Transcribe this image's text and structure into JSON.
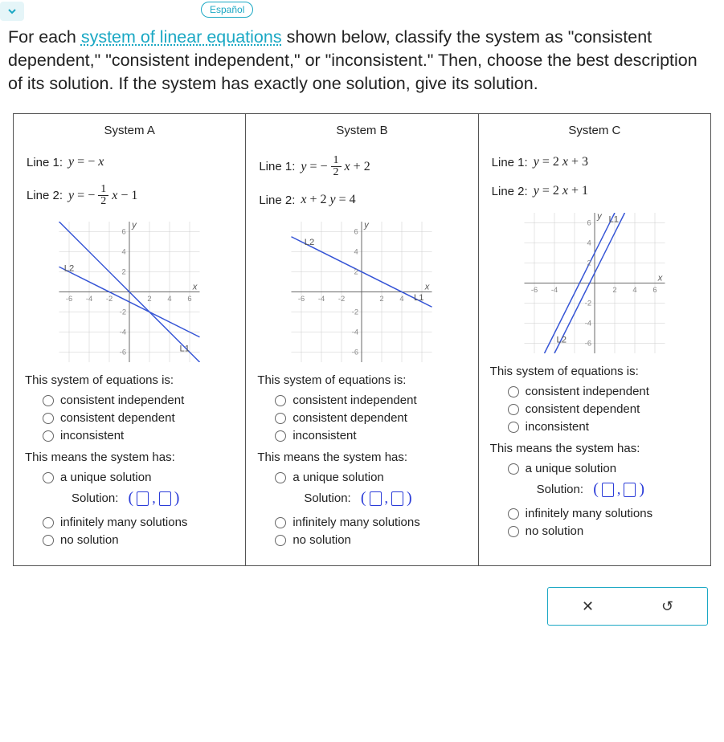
{
  "top": {
    "lang": "Español"
  },
  "question": {
    "pre": "For each ",
    "link": "system of linear equations",
    "post": " shown below, classify the system as \"consistent dependent,\" \"consistent independent,\" or \"inconsistent.\" Then, choose the best description of its solution. If the system has exactly one solution, give its solution."
  },
  "systems": {
    "A": {
      "title": "System A",
      "line1_label": "Line 1:",
      "line2_label": "Line 2:"
    },
    "B": {
      "title": "System B",
      "line1_label": "Line 1:",
      "line2_label": "Line 2:"
    },
    "C": {
      "title": "System C",
      "line1_label": "Line 1:",
      "line2_label": "Line 2:"
    }
  },
  "labels": {
    "q1": "This system of equations is:",
    "opt_ci": "consistent independent",
    "opt_cd": "consistent dependent",
    "opt_inc": "inconsistent",
    "q2": "This means the system has:",
    "opt_unique": "a unique solution",
    "solution": "Solution:",
    "opt_inf": "infinitely many solutions",
    "opt_none": "no solution"
  },
  "icons": {
    "close": "✕",
    "reset": "↺"
  },
  "chart_data": [
    {
      "system": "A",
      "type": "line",
      "xlim": [
        -7,
        7
      ],
      "ylim": [
        -7,
        7
      ],
      "xticks": [
        -6,
        -4,
        -2,
        2,
        4,
        6
      ],
      "yticks": [
        -6,
        -4,
        -2,
        2,
        4,
        6
      ],
      "xlabel": "x",
      "ylabel": "y",
      "series": [
        {
          "name": "L1",
          "equation": "y = -x",
          "points": [
            [
              -7,
              7
            ],
            [
              7,
              -7
            ]
          ],
          "label_pos": [
            5.2,
            -5.6
          ]
        },
        {
          "name": "L2",
          "equation": "y = -0.5x - 1",
          "points": [
            [
              -7,
              2.5
            ],
            [
              7,
              -4.5
            ]
          ],
          "label_pos": [
            -6.2,
            2.4
          ]
        }
      ]
    },
    {
      "system": "B",
      "type": "line",
      "xlim": [
        -7,
        7
      ],
      "ylim": [
        -7,
        7
      ],
      "xticks": [
        -6,
        -4,
        -2,
        2,
        4,
        6
      ],
      "yticks": [
        -6,
        -4,
        -2,
        2,
        4,
        6
      ],
      "xlabel": "x",
      "ylabel": "y",
      "series": [
        {
          "name": "L1",
          "equation": "y = -0.5x + 2",
          "points": [
            [
              -7,
              5.5
            ],
            [
              7,
              -1.5
            ]
          ],
          "label_pos": [
            5.4,
            -0.6
          ]
        },
        {
          "name": "L2",
          "equation": "x + 2y = 4",
          "points": [
            [
              -7,
              5.5
            ],
            [
              7,
              -1.5
            ]
          ],
          "label_pos": [
            -5.4,
            5.0
          ]
        }
      ]
    },
    {
      "system": "C",
      "type": "line",
      "xlim": [
        -7,
        7
      ],
      "ylim": [
        -7,
        7
      ],
      "xticks": [
        -6,
        -4,
        -2,
        2,
        4,
        6
      ],
      "yticks": [
        -6,
        -4,
        -2,
        2,
        4,
        6
      ],
      "xlabel": "x",
      "ylabel": "y",
      "series": [
        {
          "name": "L1",
          "equation": "y = 2x + 3",
          "points": [
            [
              -5,
              -7
            ],
            [
              2,
              7
            ]
          ],
          "label_pos": [
            1.6,
            6.3
          ]
        },
        {
          "name": "L2",
          "equation": "y = 2x + 1",
          "points": [
            [
              -4,
              -7
            ],
            [
              3,
              7
            ]
          ],
          "label_pos": [
            -3.4,
            -5.6
          ]
        }
      ]
    }
  ]
}
